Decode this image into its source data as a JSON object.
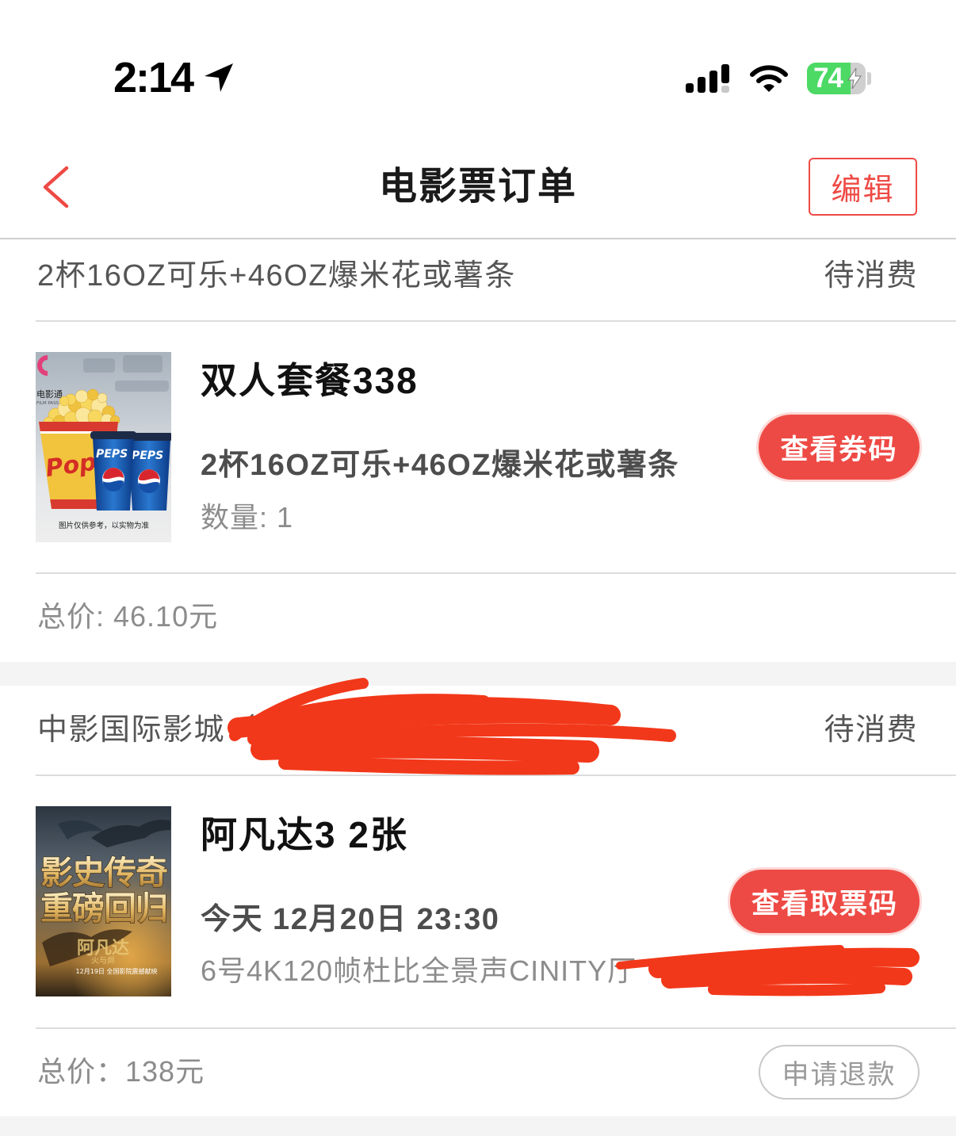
{
  "status_bar": {
    "time": "2:14",
    "battery_level": "74",
    "battery_percent": 74,
    "charging": true,
    "icons": [
      "location-arrow-icon",
      "cellular-signal-icon",
      "wifi-icon",
      "battery-icon",
      "charging-bolt-icon"
    ]
  },
  "nav": {
    "back_icon": "chevron-left-icon",
    "title": "电影票订单",
    "edit_label": "编辑"
  },
  "orders": [
    {
      "header": "2杯16OZ可乐+46OZ爆米花或薯条",
      "status": "待消费",
      "image": {
        "logo": "电影通",
        "logo_sub": "FILM PASS",
        "bucket_text": "Popc",
        "cup_text": "PEPS",
        "caption": "图片仅供参考，以实物为准"
      },
      "title": "双人套餐338",
      "line1": "2杯16OZ可乐+46OZ爆米花或薯条",
      "line2": "数量: 1",
      "action": "查看券码",
      "total": "总价: 46.10元"
    },
    {
      "header": "中影国际影城（",
      "header_redacted": true,
      "status": "待消费",
      "image": {
        "headline_1": "影史传奇",
        "headline_2": "重磅回归",
        "film_title": "阿凡达",
        "film_subtitle": "火与烬",
        "release": "12月19日 全国影院震撼献映"
      },
      "title": "阿凡达3 2张",
      "line1": "今天 12月20日 23:30",
      "line2": "6号4K120帧杜比全景声CINITY厅",
      "line2_redacted": true,
      "action": "查看取票码",
      "total": "总价：138元",
      "secondary_action": "申请退款"
    }
  ],
  "colors": {
    "accent": "#ee4a45",
    "text": "#1a1a1a",
    "muted": "#555555",
    "subtle": "#8c8c8c",
    "divider": "#dcdcdc",
    "band": "#f4f4f4",
    "battery": "#4cd964",
    "redaction": "#f2381a"
  }
}
